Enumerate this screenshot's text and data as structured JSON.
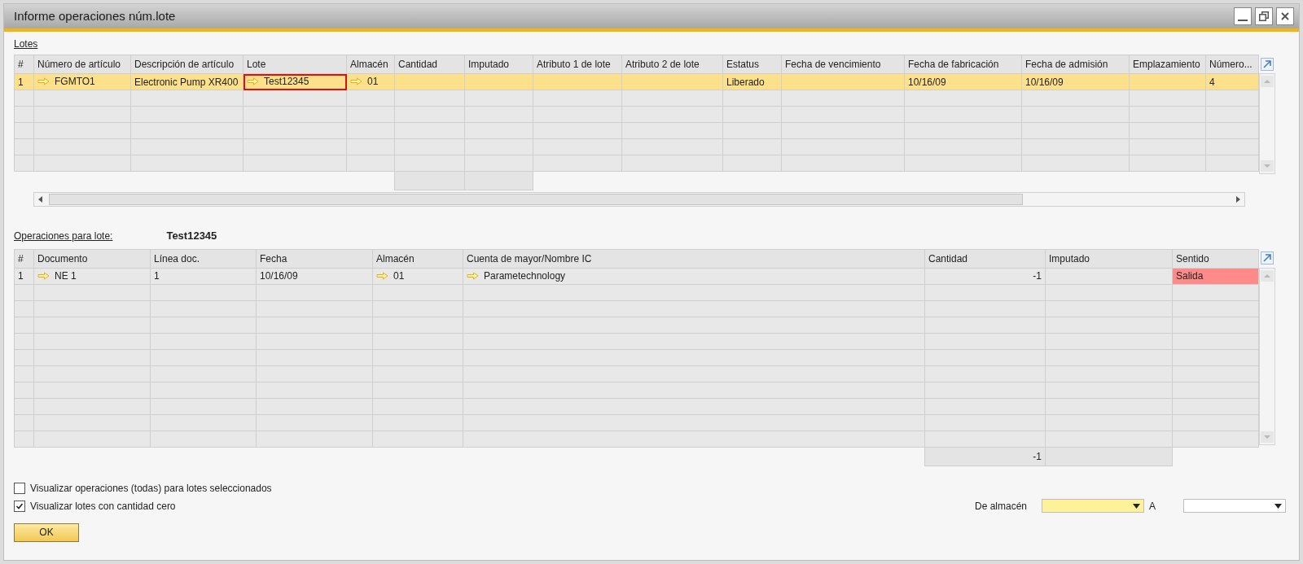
{
  "window": {
    "title": "Informe operaciones núm.lote"
  },
  "lotes": {
    "label": "Lotes",
    "columns": [
      {
        "label": "#",
        "sum": false
      },
      {
        "label": "Número de artículo",
        "sum": false
      },
      {
        "label": "Descripción de artículo",
        "sum": false
      },
      {
        "label": "Lote",
        "sum": false
      },
      {
        "label": "Almacén",
        "sum": false
      },
      {
        "label": "Cantidad",
        "sum": true
      },
      {
        "label": "Imputado",
        "sum": true
      },
      {
        "label": "Atributo 1 de lote",
        "sum": false
      },
      {
        "label": "Atributo 2 de lote",
        "sum": false
      },
      {
        "label": "Estatus",
        "sum": false
      },
      {
        "label": "Fecha de vencimiento",
        "sum": false
      },
      {
        "label": "Fecha de fabricación",
        "sum": false
      },
      {
        "label": "Fecha de admisión",
        "sum": false
      },
      {
        "label": "Emplazamiento",
        "sum": false
      },
      {
        "label": "Número...",
        "sum": false
      }
    ],
    "rows": [
      {
        "selected": true,
        "cells": [
          {
            "text": "1",
            "link": false,
            "focused": false,
            "alert": false
          },
          {
            "text": "FGMTO1",
            "link": true,
            "focused": false,
            "alert": false
          },
          {
            "text": "Electronic Pump XR400",
            "link": false,
            "focused": false,
            "alert": false
          },
          {
            "text": "Test12345",
            "link": true,
            "focused": true,
            "alert": false
          },
          {
            "text": "01",
            "link": true,
            "focused": false,
            "alert": false
          },
          null,
          null,
          null,
          null,
          {
            "text": "Liberado",
            "link": false,
            "focused": false,
            "alert": false
          },
          null,
          {
            "text": "10/16/09",
            "link": false,
            "focused": false,
            "alert": false
          },
          {
            "text": "10/16/09",
            "link": false,
            "focused": false,
            "alert": false
          },
          null,
          {
            "text": "4",
            "link": false,
            "focused": false,
            "alert": false
          }
        ]
      }
    ]
  },
  "operaciones": {
    "label": "Operaciones para lote:",
    "lote": "Test12345",
    "columns": [
      {
        "label": "#",
        "sum": false
      },
      {
        "label": "Documento",
        "sum": false
      },
      {
        "label": "Línea doc.",
        "sum": false
      },
      {
        "label": "Fecha",
        "sum": false
      },
      {
        "label": "Almacén",
        "sum": false
      },
      {
        "label": "Cuenta de mayor/Nombre IC",
        "sum": false
      },
      {
        "label": "Cantidad",
        "sum": true,
        "total": "-1"
      },
      {
        "label": "Imputado",
        "sum": true
      },
      {
        "label": "Sentido",
        "sum": false
      }
    ],
    "rows": [
      {
        "selected": false,
        "cells": [
          {
            "text": "1",
            "link": false,
            "focused": false,
            "alert": false
          },
          {
            "text": "NE 1",
            "link": true,
            "focused": false,
            "alert": false
          },
          {
            "text": "1",
            "link": false,
            "focused": false,
            "alert": false
          },
          {
            "text": "10/16/09",
            "link": false,
            "focused": false,
            "alert": false
          },
          {
            "text": "01",
            "link": true,
            "focused": false,
            "alert": false
          },
          {
            "text": "Parametechnology",
            "link": true,
            "focused": false,
            "alert": false
          },
          {
            "text": "-1",
            "link": false,
            "focused": false,
            "alert": false
          },
          null,
          {
            "text": "Salida",
            "link": false,
            "focused": false,
            "alert": true
          }
        ]
      }
    ]
  },
  "options": [
    {
      "label": "Visualizar operaciones (todas) para lotes seleccionados",
      "checked": false
    },
    {
      "label": "Visualizar lotes con cantidad cero",
      "checked": true
    }
  ],
  "filters": [
    {
      "label": "De almacén",
      "focused": true
    },
    {
      "label": "A",
      "focused": false
    }
  ],
  "buttons": [
    {
      "label": "OK"
    }
  ]
}
